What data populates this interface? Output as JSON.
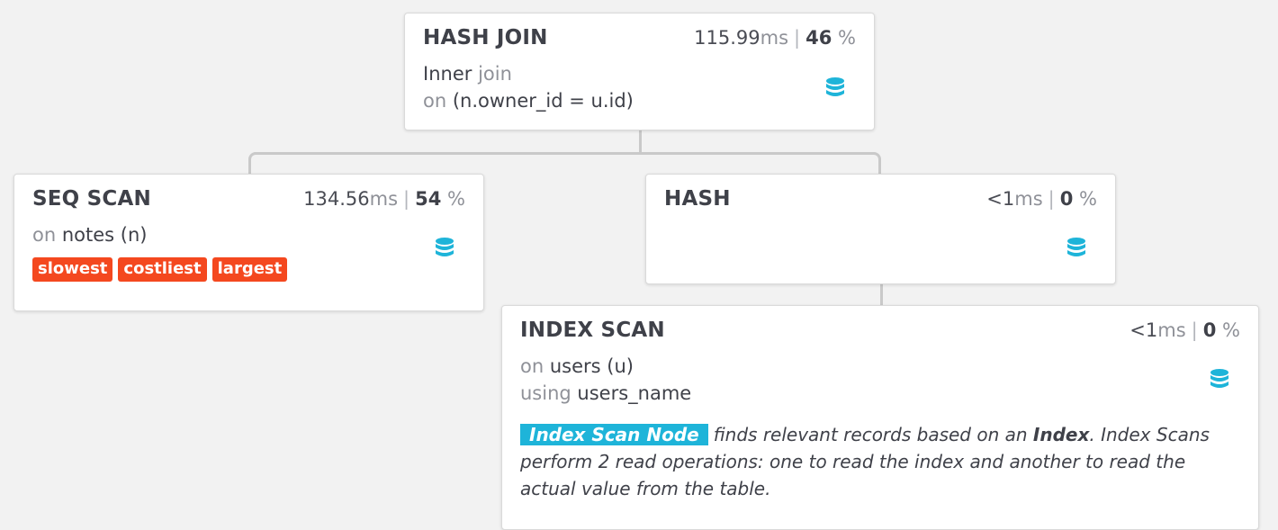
{
  "accent_color": "#1eb4d9",
  "tag_color": "#f4481f",
  "icon": "database-icon",
  "hash_join": {
    "title": "HASH JOIN",
    "time_value": "115.99",
    "time_unit": "ms",
    "percent_value": "46",
    "percent_sign": "%",
    "join_type": "Inner",
    "join_word": "join",
    "on_word": "on",
    "condition": "(n.owner_id = u.id)"
  },
  "seq_scan": {
    "title": "SEQ SCAN",
    "time_value": "134.56",
    "time_unit": "ms",
    "percent_value": "54",
    "percent_sign": "%",
    "on_word": "on",
    "relation": "notes (n)",
    "tags": [
      "slowest",
      "costliest",
      "largest"
    ]
  },
  "hash": {
    "title": "HASH",
    "time_value": "<1",
    "time_unit": "ms",
    "percent_value": "0",
    "percent_sign": "%"
  },
  "index_scan": {
    "title": "INDEX SCAN",
    "time_value": "<1",
    "time_unit": "ms",
    "percent_value": "0",
    "percent_sign": "%",
    "on_word": "on",
    "relation": "users (u)",
    "using_word": "using",
    "index_name": "users_name",
    "description": {
      "badge": "Index Scan Node",
      "text_1": "finds relevant records based on an",
      "bold_word": "Index",
      "text_2": ". Index Scans perform 2 read operations: one to read the index and another to read the actual value from the table."
    }
  }
}
